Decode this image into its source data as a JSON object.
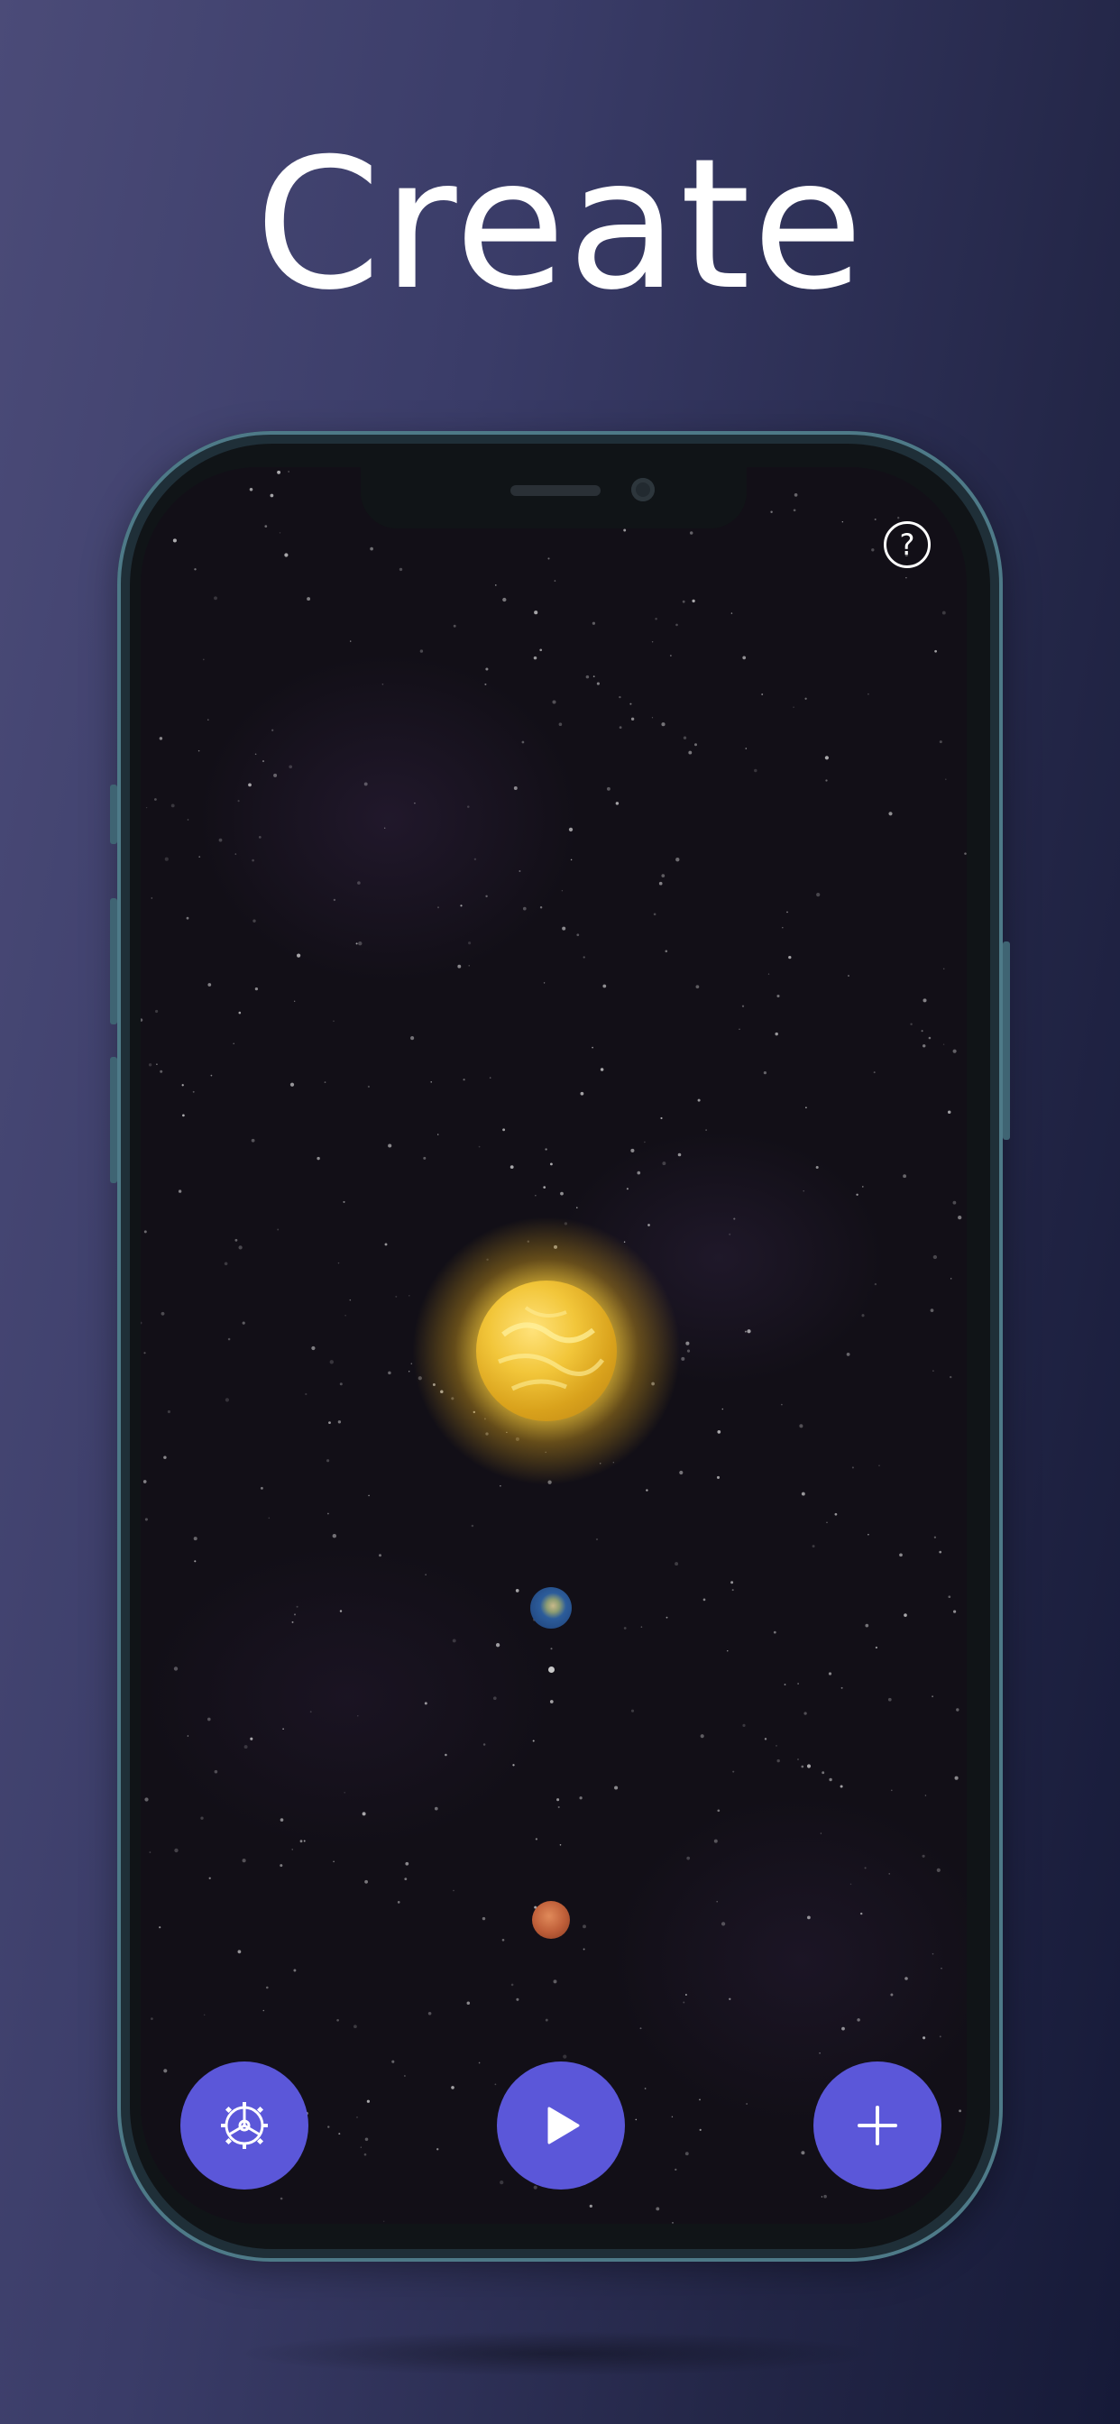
{
  "headline": "Create",
  "help_button": {
    "label": "?"
  },
  "colors": {
    "accent": "#5b57d9",
    "sun": "#f2c63a",
    "background": "#120f17"
  },
  "scene": {
    "bodies": [
      "sun",
      "earth",
      "moon",
      "mars"
    ]
  },
  "bottom_bar": {
    "settings_icon": "gear-icon",
    "play_icon": "play-icon",
    "add_icon": "plus-icon"
  }
}
